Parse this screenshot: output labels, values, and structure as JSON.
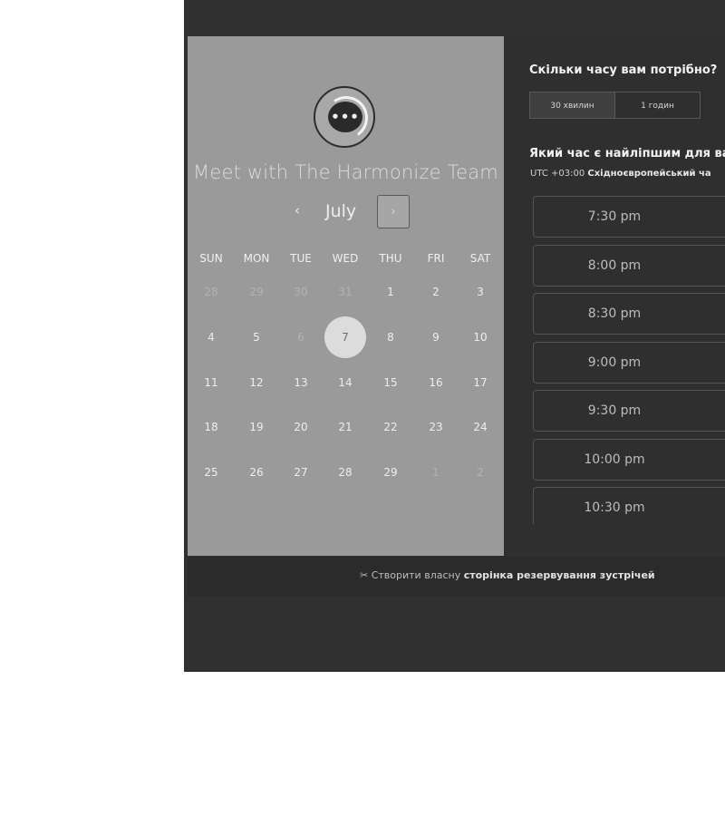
{
  "header": {
    "title": "Meet with The Harmonize Team"
  },
  "calendar": {
    "month": "July",
    "prev_label": "‹",
    "next_label": "›",
    "weekdays": [
      "SUN",
      "MON",
      "TUE",
      "WED",
      "THU",
      "FRI",
      "SAT"
    ],
    "weeks": [
      [
        {
          "d": "28",
          "m": true
        },
        {
          "d": "29",
          "m": true
        },
        {
          "d": "30",
          "m": true
        },
        {
          "d": "31",
          "m": true
        },
        {
          "d": "1"
        },
        {
          "d": "2"
        },
        {
          "d": "3"
        }
      ],
      [
        {
          "d": "4"
        },
        {
          "d": "5"
        },
        {
          "d": "6",
          "m": true
        },
        {
          "d": "7",
          "sel": true
        },
        {
          "d": "8"
        },
        {
          "d": "9"
        },
        {
          "d": "10"
        }
      ],
      [
        {
          "d": "11"
        },
        {
          "d": "12"
        },
        {
          "d": "13"
        },
        {
          "d": "14"
        },
        {
          "d": "15"
        },
        {
          "d": "16"
        },
        {
          "d": "17"
        }
      ],
      [
        {
          "d": "18"
        },
        {
          "d": "19"
        },
        {
          "d": "20"
        },
        {
          "d": "21"
        },
        {
          "d": "22"
        },
        {
          "d": "23"
        },
        {
          "d": "24"
        }
      ],
      [
        {
          "d": "25"
        },
        {
          "d": "26"
        },
        {
          "d": "27"
        },
        {
          "d": "28"
        },
        {
          "d": "29"
        },
        {
          "d": "1",
          "m": true
        },
        {
          "d": "2",
          "m": true
        }
      ]
    ]
  },
  "duration": {
    "question": "Скільки часу вам потрібно?",
    "options": [
      {
        "label": "30 хвилин",
        "active": true
      },
      {
        "label": "1 годин",
        "active": false
      }
    ]
  },
  "times": {
    "question": "Який час є найліпшим для вас?",
    "timezone_prefix": "UTC +03:00",
    "timezone_name": "Східноєвропейський ча",
    "slots": [
      "7:30 pm",
      "8:00 pm",
      "8:30 pm",
      "9:00 pm",
      "9:30 pm",
      "10:00 pm",
      "10:30 pm"
    ]
  },
  "footer": {
    "prefix": "Створити власну",
    "link": "сторінка резервування зустрічей"
  }
}
